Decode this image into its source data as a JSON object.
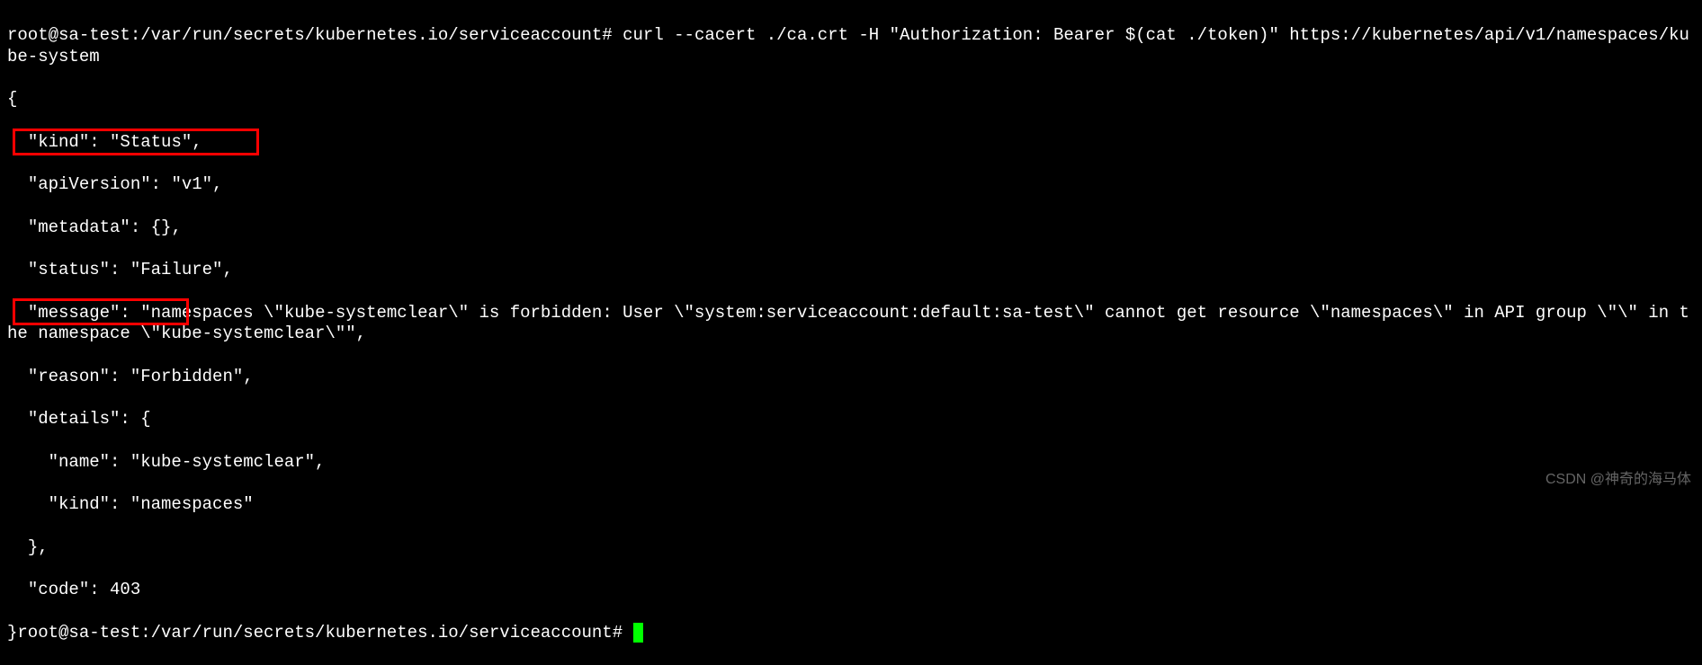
{
  "terminal": {
    "prompt1": "root@sa-test:/var/run/secrets/kubernetes.io/serviceaccount# ",
    "command": "curl --cacert ./ca.crt -H \"Authorization: Bearer $(cat ./token)\" https://kubernetes/api/v1/namespaces/kube-system",
    "output": {
      "l1": "{",
      "l2": "  \"kind\": \"Status\",",
      "l3": "  \"apiVersion\": \"v1\",",
      "l4": "  \"metadata\": {},",
      "l5": "  \"status\": \"Failure\",",
      "l6": "  \"message\": \"namespaces \\\"kube-systemclear\\\" is forbidden: User \\\"system:serviceaccount:default:sa-test\\\" cannot get resource \\\"namespaces\\\" in API group \\\"\\\" in the namespace \\\"kube-systemclear\\\"\",",
      "l7": "  \"reason\": \"Forbidden\",",
      "l8": "  \"details\": {",
      "l9": "    \"name\": \"kube-systemclear\",",
      "l10": "    \"kind\": \"namespaces\"",
      "l11": "  },",
      "l12": "  \"code\": 403",
      "l13_prefix": "}"
    },
    "prompt2": "root@sa-test:/var/run/secrets/kubernetes.io/serviceaccount# "
  },
  "watermark": "CSDN @神奇的海马体"
}
